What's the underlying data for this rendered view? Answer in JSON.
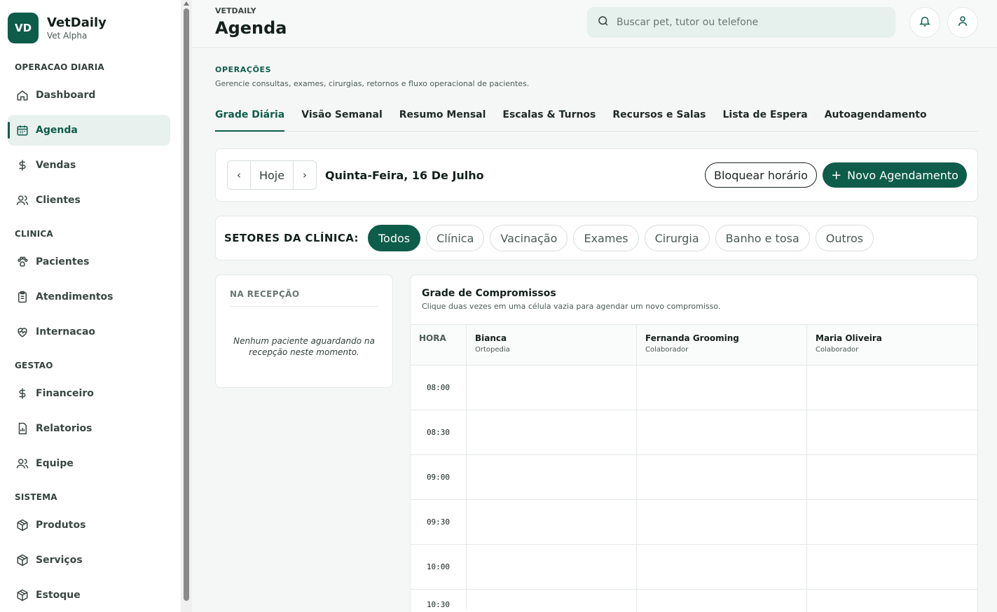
{
  "brand": {
    "initials": "VD",
    "name": "VetDaily",
    "subtitle": "Vet Alpha"
  },
  "sidebar": {
    "sections": [
      {
        "title": "OPERACAO DIARIA",
        "items": [
          {
            "label": "Dashboard",
            "icon": "home-icon"
          },
          {
            "label": "Agenda",
            "icon": "calendar-icon",
            "active": true
          },
          {
            "label": "Vendas",
            "icon": "dollar-icon"
          },
          {
            "label": "Clientes",
            "icon": "users-icon"
          }
        ]
      },
      {
        "title": "CLINICA",
        "items": [
          {
            "label": "Pacientes",
            "icon": "paw-icon"
          },
          {
            "label": "Atendimentos",
            "icon": "clipboard-icon"
          },
          {
            "label": "Internacao",
            "icon": "heart-pulse-icon"
          }
        ]
      },
      {
        "title": "GESTAO",
        "items": [
          {
            "label": "Financeiro",
            "icon": "dollar-icon"
          },
          {
            "label": "Relatorios",
            "icon": "report-icon"
          },
          {
            "label": "Equipe",
            "icon": "users-icon"
          }
        ]
      },
      {
        "title": "SISTEMA",
        "items": [
          {
            "label": "Produtos",
            "icon": "box-icon"
          },
          {
            "label": "Serviços",
            "icon": "box-icon"
          },
          {
            "label": "Estoque",
            "icon": "box-icon"
          }
        ]
      }
    ]
  },
  "header": {
    "kicker": "VETDAILY",
    "title": "Agenda",
    "search_placeholder": "Buscar pet, tutor ou telefone"
  },
  "ops": {
    "kicker": "OPERAÇÕES",
    "description": "Gerencie consultas, exames, cirurgias, retornos e fluxo operacional de pacientes."
  },
  "tabs": [
    {
      "label": "Grade Diária",
      "active": true
    },
    {
      "label": "Visão Semanal"
    },
    {
      "label": "Resumo Mensal"
    },
    {
      "label": "Escalas & Turnos"
    },
    {
      "label": "Recursos e Salas"
    },
    {
      "label": "Lista de Espera"
    },
    {
      "label": "Autoagendamento"
    }
  ],
  "date_bar": {
    "prev": "‹",
    "today": "Hoje",
    "next": "›",
    "date_label": "Quinta-Feira, 16 De Julho",
    "block_button": "Bloquear horário",
    "new_button": "Novo Agendamento",
    "new_button_icon": "+"
  },
  "sectors": {
    "label": "SETORES DA CLÍNICA:",
    "chips": [
      {
        "label": "Todos",
        "active": true
      },
      {
        "label": "Clínica"
      },
      {
        "label": "Vacinação"
      },
      {
        "label": "Exames"
      },
      {
        "label": "Cirurgia"
      },
      {
        "label": "Banho e tosa"
      },
      {
        "label": "Outros"
      }
    ]
  },
  "reception": {
    "title": "NA RECEPÇÃO",
    "empty_text": "Nenhum paciente aguardando na recepção neste momento."
  },
  "schedule": {
    "title": "Grade de Compromissos",
    "subtitle": "Clique duas vezes em uma célula vazia para agendar um novo compromisso.",
    "hour_header": "HORA",
    "staff": [
      {
        "name": "Bianca",
        "role": "Ortopedia"
      },
      {
        "name": "Fernanda Grooming",
        "role": "Colaborador"
      },
      {
        "name": "Maria Oliveira",
        "role": "Colaborador"
      }
    ],
    "hours": [
      "08:00",
      "08:30",
      "09:00",
      "09:30",
      "10:00",
      "10:30"
    ]
  },
  "colors": {
    "primary": "#0e5c4a",
    "active_bg": "#e9f1ee",
    "search_bg": "#e6f0ed"
  }
}
